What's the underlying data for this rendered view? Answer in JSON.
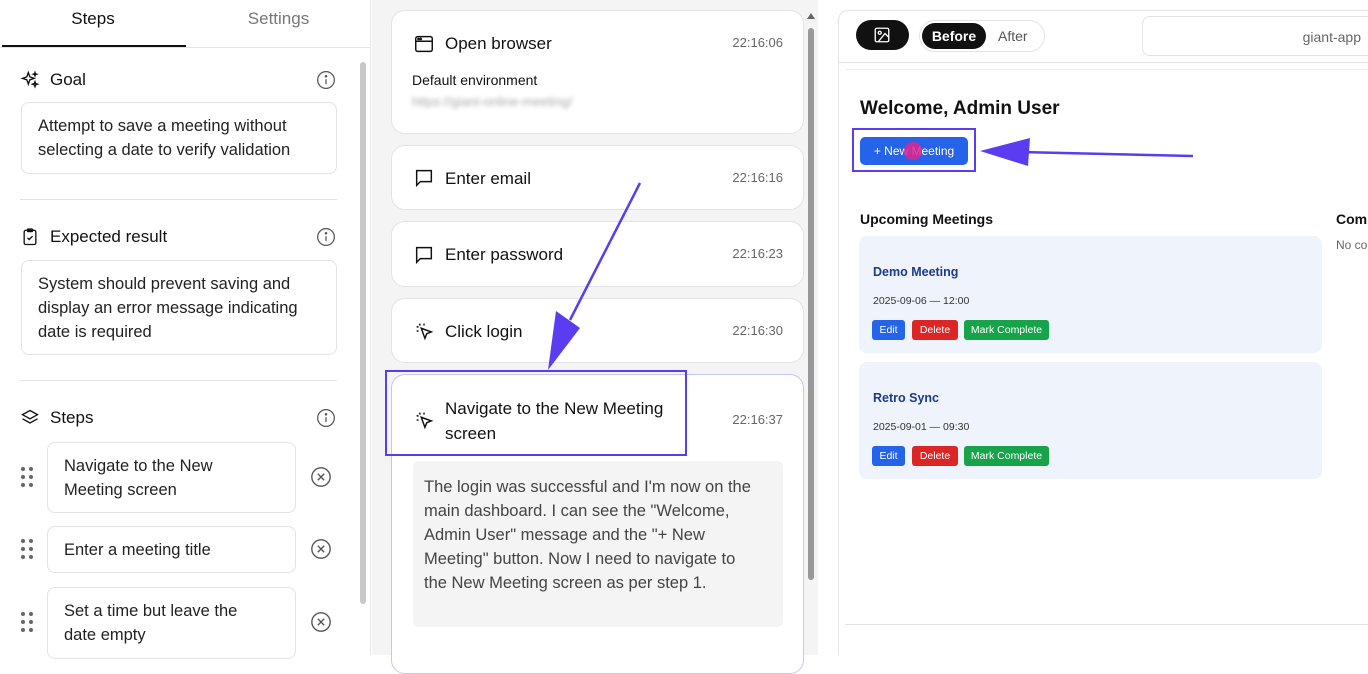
{
  "tabs": {
    "steps": "Steps",
    "settings": "Settings"
  },
  "goal": {
    "heading": "Goal",
    "text_line1": "Attempt to save a meeting without",
    "text_line2": "selecting a date to verify validation"
  },
  "expected": {
    "heading": "Expected result",
    "line1": "System should prevent saving and",
    "line2": "display an error message indicating",
    "line3": "date is required"
  },
  "steps_section": {
    "heading": "Steps",
    "items": [
      {
        "line1": "Navigate to the New",
        "line2": "Meeting screen"
      },
      {
        "line1": "Enter a meeting title",
        "line2": ""
      },
      {
        "line1": "Set a time but leave the",
        "line2": "date empty"
      }
    ]
  },
  "timeline": {
    "items": [
      {
        "title": "Open browser",
        "time": "22:16:06",
        "subtitle": "Default environment",
        "url": "https://giant-online-meeting/"
      },
      {
        "title": "Enter email",
        "time": "22:16:16"
      },
      {
        "title": "Enter password",
        "time": "22:16:23"
      },
      {
        "title": "Click login",
        "time": "22:16:30"
      },
      {
        "title_line1": "Navigate to the New Meeting",
        "title_line2": "screen",
        "time": "22:16:37"
      }
    ],
    "reasoning": [
      "The login was successful and I'm now on the",
      "main dashboard. I can see the \"Welcome,",
      "Admin User\" message and the \"+ New",
      "Meeting\" button. Now I need to navigate to",
      "the New Meeting screen as per step 1."
    ]
  },
  "preview": {
    "before_label": "Before",
    "after_label": "After",
    "url": "giant-app",
    "welcome": "Welcome, Admin User",
    "new_meeting_btn": "+ New Meeting",
    "upcoming_heading": "Upcoming Meetings",
    "completed_heading": "Comp",
    "completed_empty": "No co",
    "meetings": [
      {
        "title": "Demo Meeting",
        "date": "2025-09-06 — 12:00"
      },
      {
        "title": "Retro Sync",
        "date": "2025-09-01 — 09:30"
      }
    ],
    "edit_label": "Edit",
    "delete_label": "Delete",
    "complete_label": "Mark Complete"
  },
  "colors": {
    "accent": "#5b3cf0",
    "primary_btn": "#2563eb",
    "danger": "#dc2626",
    "success": "#16a34a"
  }
}
